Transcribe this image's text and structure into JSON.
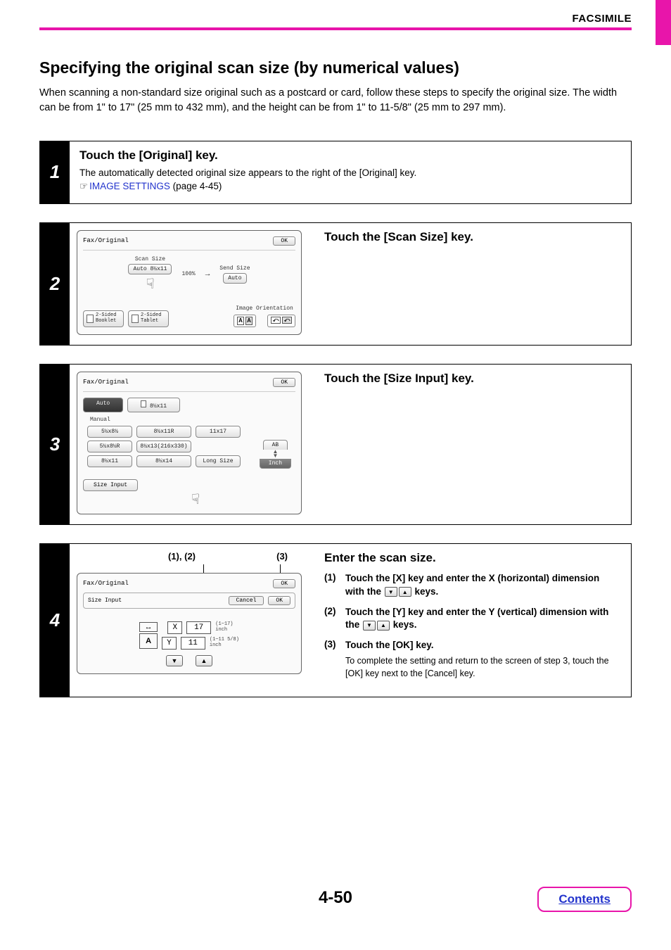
{
  "header": {
    "section": "FACSIMILE"
  },
  "title": "Specifying the original scan size (by numerical values)",
  "intro": "When scanning a non-standard size original such as a postcard or card, follow these steps to specify the original size. The width can be from 1\" to 17\" (25 mm to 432 mm), and the height can be from 1\" to 11-5/8\" (25 mm to 297 mm).",
  "steps": {
    "s1": {
      "num": "1",
      "title": "Touch the [Original] key.",
      "desc_pre": "The automatically detected original size appears to the right of the [Original] key.",
      "icon": "☞",
      "link_text": "IMAGE SETTINGS",
      "link_suffix": " (page 4-45)"
    },
    "s2": {
      "num": "2",
      "title": "Touch the [Scan Size] key.",
      "panel": {
        "breadcrumb": "Fax/Original",
        "ok": "OK",
        "scan_label": "Scan Size",
        "scan_value": "Auto  8½x11",
        "percent": "100%",
        "send_label": "Send Size",
        "send_value": "Auto",
        "booklet": "2-Sided\nBooklet",
        "tablet": "2-Sided\nTablet",
        "orientation_label": "Image Orientation"
      }
    },
    "s3": {
      "num": "3",
      "title": "Touch the [Size Input] key.",
      "panel": {
        "breadcrumb": "Fax/Original",
        "ok": "OK",
        "tab_auto": "Auto",
        "tab_size": "8½x11",
        "manual": "Manual",
        "sizes": [
          "5½x8½",
          "8½x11R",
          "11x17",
          "5½x8½R",
          "8½x13(216x330)",
          "",
          "8½x11",
          "8½x14",
          "Long Size"
        ],
        "ab": "AB",
        "inch": "Inch",
        "size_input": "Size Input"
      }
    },
    "s4": {
      "num": "4",
      "title": "Enter the scan size.",
      "callout_l": "(1), (2)",
      "callout_r": "(3)",
      "panel": {
        "breadcrumb": "Fax/Original",
        "ok_top": "OK",
        "sub_label": "Size Input",
        "cancel": "Cancel",
        "ok_sub": "OK",
        "x_label": "X",
        "x_val": "17",
        "x_range": "(1~17)\ninch",
        "y_label": "Y",
        "y_val": "11",
        "y_range": "(1~11 5/8)\ninch"
      },
      "substeps": {
        "a": {
          "n": "(1)",
          "t1": "Touch the [X] key and enter the X (horizontal) dimension with the ",
          "t2": " keys."
        },
        "b": {
          "n": "(2)",
          "t1": "Touch the [Y] key and enter the Y (vertical) dimension with the ",
          "t2": " keys."
        },
        "c": {
          "n": "(3)",
          "t1": "Touch the [OK] key.",
          "note": "To complete the setting and return to the screen of step 3, touch the [OK] key next to the [Cancel] key."
        }
      }
    }
  },
  "page_num": "4-50",
  "contents": "Contents"
}
